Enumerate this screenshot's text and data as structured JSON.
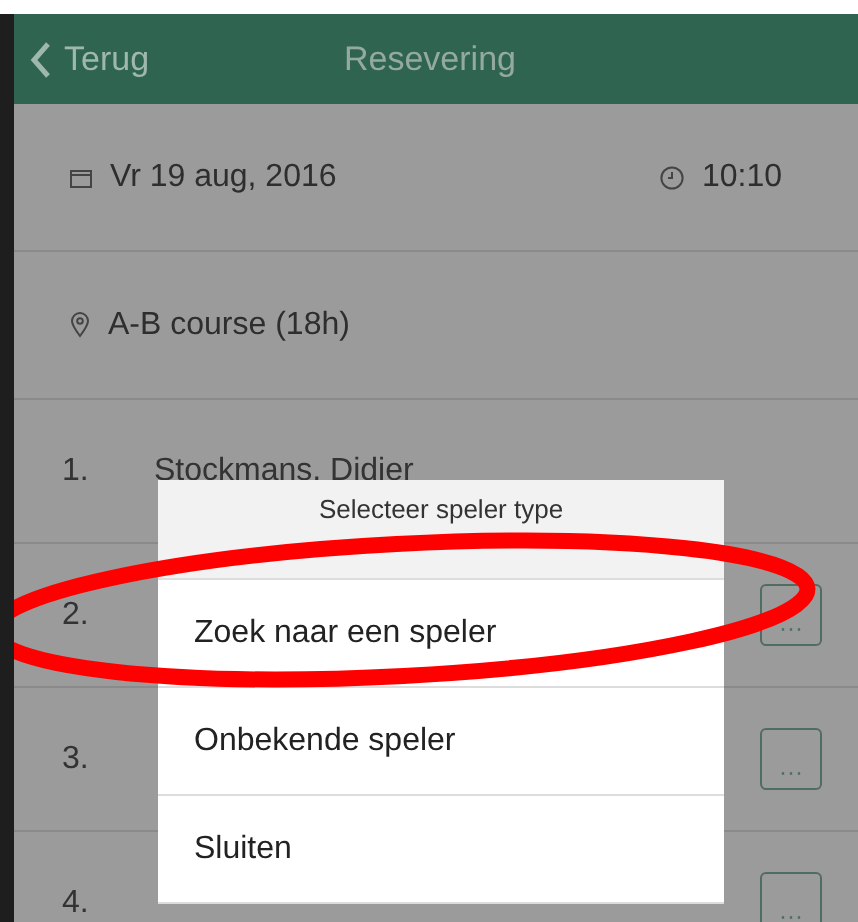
{
  "header": {
    "back_label": "Terug",
    "title": "Resevering"
  },
  "date": "Vr 19 aug, 2016",
  "time": "10:10",
  "course": "A-B course (18h)",
  "players": [
    {
      "number": "1.",
      "name": "Stockmans, Didier"
    },
    {
      "number": "2.",
      "menu_label": "···"
    },
    {
      "number": "3.",
      "menu_label": "···"
    },
    {
      "number": "4.",
      "menu_label": "···"
    }
  ],
  "sheet": {
    "title": "Selecteer speler type",
    "options": [
      "Zoek naar een speler",
      "Onbekende speler",
      "Sluiten"
    ]
  },
  "annotation": {
    "kind": "ellipse"
  }
}
